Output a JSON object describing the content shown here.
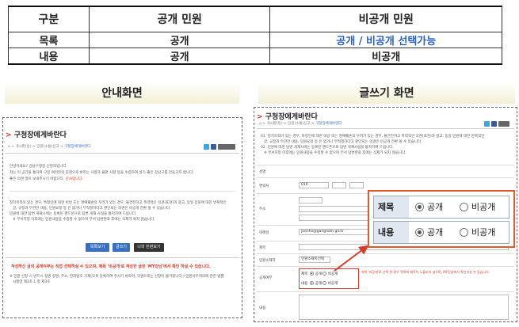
{
  "table": {
    "headers": [
      "구분",
      "공개 민원",
      "비공개 민원"
    ],
    "rows": [
      [
        "목록",
        "공개",
        "공개 / 비공개 선택가능"
      ],
      [
        "내용",
        "공개",
        "비공개"
      ]
    ]
  },
  "captions": {
    "left": "안내화면",
    "right": "글쓰기 화면"
  },
  "left_screen": {
    "title": "구청장에게바란다",
    "breadcrumb_home": "⌂",
    "breadcrumb_path": "> 게시판(등) > 민원(소통)신고 >",
    "breadcrumb_current": "구청장에게바란다",
    "greeting": "안녕하세요? 강남구청장 신연희입니다.",
    "intro": "저는 이 공간을 통하여 구민 여러분의 진정으로 바라는 사항과 불편 사항 등을 수렴하여 살기 좋은 강남구를 만들고자 합니다.",
    "intro2": "좋은 의견 많이 보내주시기 바랍니다.",
    "thanks": "감사합니다.",
    "notice1": "정치목적이 있는 경우, 특정인에 대한 비방 또는 명예훼손의 우려가 있는 경우, 불건전하고 폭력적인 의견(표현)과 광고, 동일 민원에 대한 반복적인",
    "notice1b": "글, 규정과 무관한 내용, 민원요청 등 은 없거나 부적절하다고 판단되는 의견은 비공개 전환 될 수 있습니다.",
    "notice2": "민원에 대한 답변 게재시에는 등록된 핸드폰으로 답변 게재 사실을 통지하여 드립니다.",
    "notice3": "※ 부서지정 이후에는 민원내용을 수정할 수 없으며 부서 답변완료 후에는 삭제가 되지 않습니다.",
    "buttons": [
      "목록보기",
      "글쓰기",
      "나의 민원보기"
    ],
    "warn": "작성하신 글의 공개여부는 직접 선택하실 수 있으며, 제목 '비공개'로 작성한 글은 'MY강남'에서 확인 하실 수 있습니다.",
    "footer1": "※ 민원 신청 시 반드시 실명 실명, 주소, 전화번호 기재(모로 등록하여 주시기 바라며, 익명으로는 신청이 불가합니다.) 민원사무처리에 관한 법률",
    "footer2": "시행령 제2조 1 항 제3호"
  },
  "right_screen": {
    "title": "구청장에게바란다",
    "breadcrumb_home": "⌂",
    "breadcrumb_path": "> 게시판(등) > 민원(소통)신고 >",
    "breadcrumb_current": "구청장에게바란다",
    "notice1": "01. 정치목적이 있는 경우, 특정인에 대한 비방 또는 명예훼손의 우려가 있는 경우, 불건전하고 폭력적인 의견(표현)과 광고, 동일 민원에 대한 반복적인",
    "notice1b": "글, 규정과 무관한 내용, 민원요청 등 은 없거나 부적절하다고 판단되는 의견은 비공개 전환 될 수 있습니다.",
    "notice2": "02. 민원에 대한 답변 게재시에는 등록된 핸드폰으로 답변 게재사실을 통지하여 드립니다.",
    "notice3": "※ 부서지정 이후에는 민원내용을 수정할 수 없으며 부서 답변완료 후에는 삭제가 되지 않습니다.",
    "fields": {
      "name_label": "성명",
      "phone_label": "연락처",
      "phone_prefix": "010",
      "address_label": "주소",
      "email_label": "이메일",
      "email_value": "joonho@gangnam.go.kr",
      "subject_label": "제목",
      "type_label": "민원소재지",
      "type_value": "민원소재지선택",
      "open_label": "공개여부",
      "content_label": "내용"
    },
    "mini_rows": [
      {
        "label": "제목",
        "opt1": "공개",
        "opt2": "비공개"
      },
      {
        "label": "내용",
        "opt1": "공개",
        "opt2": "비공개"
      }
    ],
    "red_note": "제목 '비공개'로 선택 한 경우 목록에 제목이 노출되지 않으며, MY강남에서 확인하실 수 있습니다."
  },
  "zoom_panel": {
    "rows": [
      {
        "label": "제목",
        "opt1": "공개",
        "opt2": "비공개",
        "selected": "opt1"
      },
      {
        "label": "내용",
        "opt1": "공개",
        "opt2": "비공개",
        "selected": "opt1"
      }
    ]
  },
  "colors": {
    "accent_blue": "#2a63c7",
    "highlight_orange": "#e05a2b",
    "warning_red": "#d83a2a"
  }
}
